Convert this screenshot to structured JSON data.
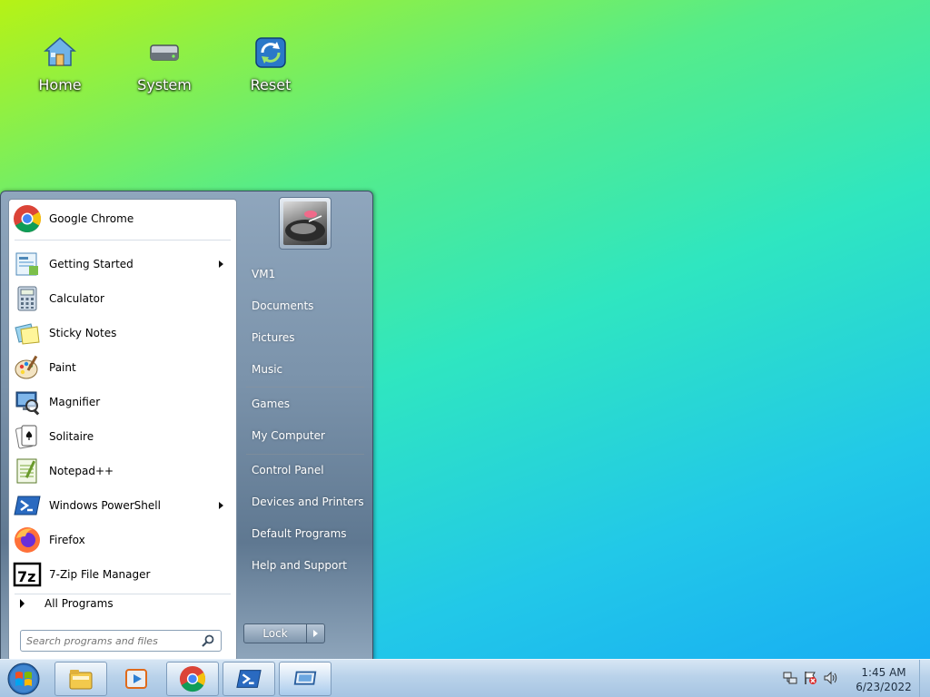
{
  "desktop": {
    "icons": [
      {
        "label": "Home",
        "icon": "home-icon"
      },
      {
        "label": "System",
        "icon": "system-drive-icon"
      },
      {
        "label": "Reset",
        "icon": "reset-icon"
      }
    ]
  },
  "start_menu": {
    "programs": [
      {
        "label": "Google Chrome",
        "icon": "chrome-icon",
        "submenu": false
      },
      {
        "label": "Getting Started",
        "icon": "getting-started-icon",
        "submenu": true
      },
      {
        "label": "Calculator",
        "icon": "calculator-icon",
        "submenu": false
      },
      {
        "label": "Sticky Notes",
        "icon": "sticky-notes-icon",
        "submenu": false
      },
      {
        "label": "Paint",
        "icon": "paint-icon",
        "submenu": false
      },
      {
        "label": "Magnifier",
        "icon": "magnifier-icon",
        "submenu": false
      },
      {
        "label": "Solitaire",
        "icon": "solitaire-icon",
        "submenu": false
      },
      {
        "label": "Notepad++",
        "icon": "notepadpp-icon",
        "submenu": false
      },
      {
        "label": "Windows PowerShell",
        "icon": "powershell-icon",
        "submenu": true
      },
      {
        "label": "Firefox",
        "icon": "firefox-icon",
        "submenu": false
      },
      {
        "label": "7-Zip File Manager",
        "icon": "7zip-icon",
        "submenu": false
      }
    ],
    "all_programs_label": "All Programs",
    "search": {
      "placeholder": "Search programs and files",
      "value": ""
    },
    "right_links": [
      {
        "label": "VM1"
      },
      {
        "label": "Documents"
      },
      {
        "label": "Pictures"
      },
      {
        "label": "Music"
      },
      {
        "label": "Games"
      },
      {
        "label": "My Computer"
      },
      {
        "label": "Control Panel"
      },
      {
        "label": "Devices and Printers"
      },
      {
        "label": "Default Programs"
      },
      {
        "label": "Help and Support"
      }
    ],
    "lock_label": "Lock"
  },
  "taskbar": {
    "pinned": [
      {
        "name": "explorer",
        "icon": "folder-icon"
      },
      {
        "name": "media-player",
        "icon": "media-player-icon"
      },
      {
        "name": "chrome",
        "icon": "chrome-icon"
      },
      {
        "name": "powershell",
        "icon": "powershell-icon"
      },
      {
        "name": "rdp",
        "icon": "remote-desktop-icon"
      }
    ],
    "tray_icons": [
      "network-icon",
      "action-center-flag-icon",
      "volume-icon"
    ],
    "clock": {
      "time": "1:45 AM",
      "date": "6/23/2022"
    }
  }
}
